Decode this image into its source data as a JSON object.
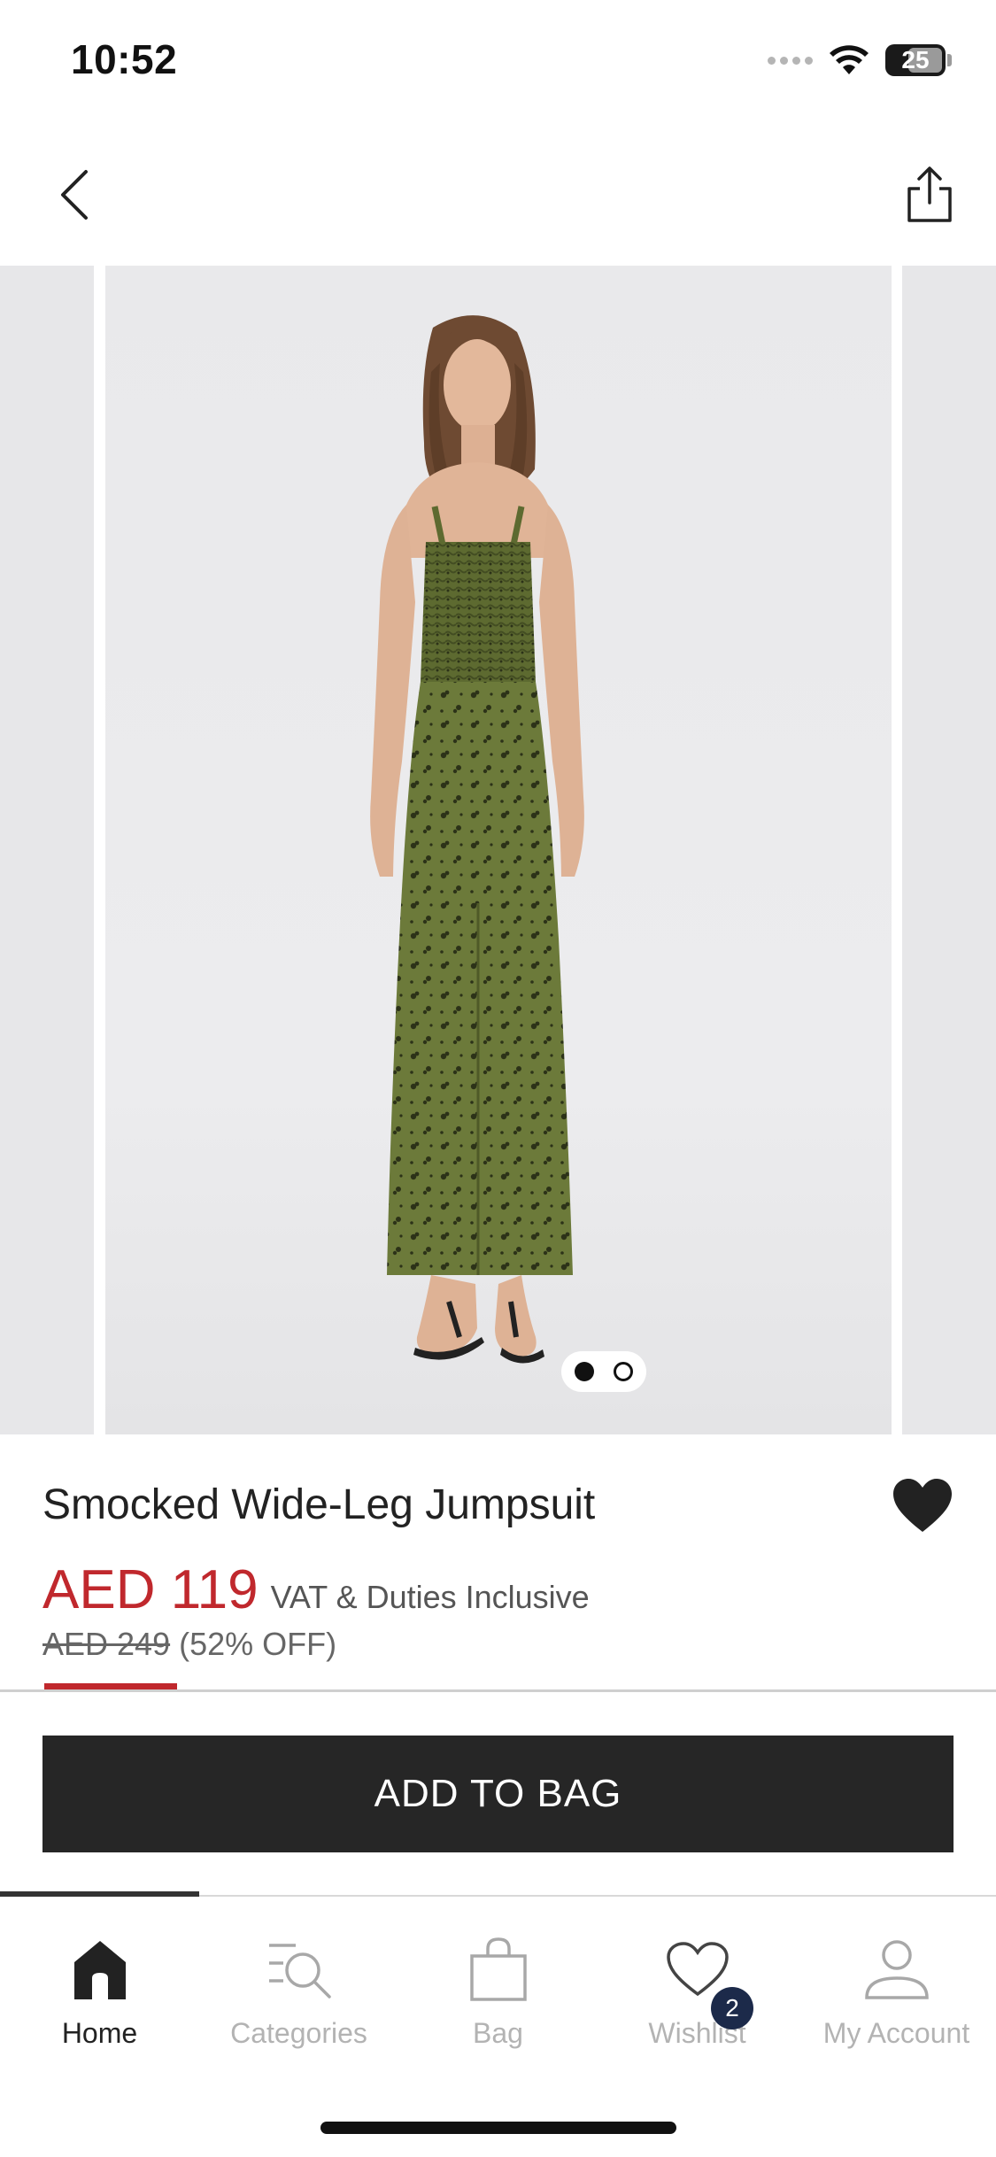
{
  "status_bar": {
    "time": "10:52",
    "battery": "25",
    "icons": [
      "signal-icon",
      "wifi-icon",
      "battery-icon"
    ]
  },
  "nav": {
    "back_icon": "chevron-left-icon",
    "share_icon": "share-icon"
  },
  "gallery": {
    "image_count": 2,
    "active_index": 1
  },
  "product": {
    "title": "Smocked Wide-Leg Jumpsuit",
    "sale_price": "AED 119",
    "vat_note": "VAT & Duties Inclusive",
    "original_price": "AED 249",
    "discount": "(52% OFF)",
    "wishlisted": true
  },
  "actions": {
    "add_to_bag": "ADD TO BAG"
  },
  "tab_bar": {
    "items": [
      {
        "label": "Home",
        "icon": "home-icon",
        "active": true
      },
      {
        "label": "Categories",
        "icon": "categories-search-icon",
        "active": false
      },
      {
        "label": "Bag",
        "icon": "bag-icon",
        "active": false
      },
      {
        "label": "Wishlist",
        "icon": "heart-icon",
        "active": false,
        "badge": "2"
      },
      {
        "label": "My Account",
        "icon": "user-icon",
        "active": false
      }
    ]
  },
  "colors": {
    "accent_red": "#c0282d",
    "button_dark": "#262626",
    "badge_navy": "#1c2a4a"
  }
}
